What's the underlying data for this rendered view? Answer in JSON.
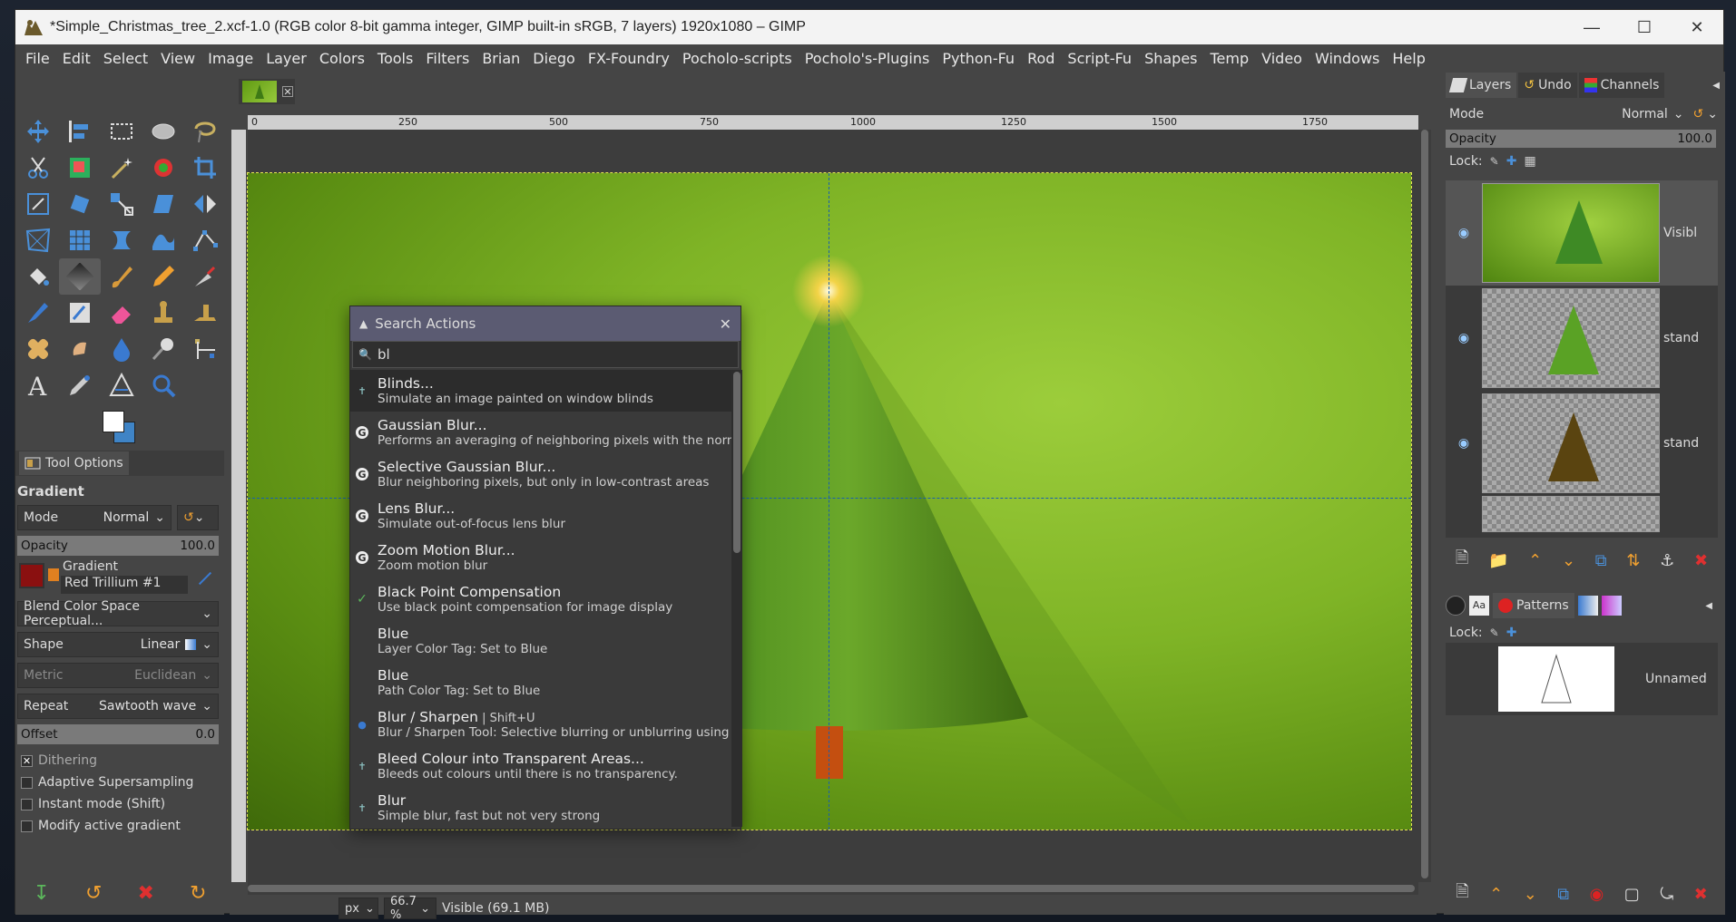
{
  "window": {
    "title": "*Simple_Christmas_tree_2.xcf-1.0 (RGB color 8-bit gamma integer, GIMP built-in sRGB, 7 layers) 1920x1080 – GIMP"
  },
  "menu": [
    "File",
    "Edit",
    "Select",
    "View",
    "Image",
    "Layer",
    "Colors",
    "Tools",
    "Filters",
    "Brian",
    "Diego",
    "FX-Foundry",
    "Pocholo-scripts",
    "Pocholo's-Plugins",
    "Python-Fu",
    "Rod",
    "Script-Fu",
    "Shapes",
    "Temp",
    "Video",
    "Windows",
    "Help"
  ],
  "tool_options": {
    "tab_label": "Tool Options",
    "tool_name": "Gradient",
    "mode_label": "Mode",
    "mode_value": "Normal",
    "opacity_label": "Opacity",
    "opacity_value": "100.0",
    "gradient_label": "Gradient",
    "gradient_value": "Red Trillium #1",
    "blend_space": "Blend Color Space Perceptual...",
    "shape_label": "Shape",
    "shape_value": "Linear",
    "metric_label": "Metric",
    "metric_value": "Euclidean",
    "repeat_label": "Repeat",
    "repeat_value": "Sawtooth wave",
    "offset_label": "Offset",
    "offset_value": "0.0",
    "checks": [
      {
        "label": "Dithering",
        "checked": true
      },
      {
        "label": "Adaptive Supersampling",
        "checked": false
      },
      {
        "label": "Instant mode  (Shift)",
        "checked": false
      },
      {
        "label": "Modify active gradient",
        "checked": false
      }
    ]
  },
  "ruler": [
    "0",
    "250",
    "500",
    "750",
    "1000",
    "1250",
    "1500",
    "1750"
  ],
  "status": {
    "unit": "px",
    "zoom": "66.7 %",
    "info": "Visible (69.1 MB)"
  },
  "search_dialog": {
    "title": "Search Actions",
    "query": "bl",
    "results": [
      {
        "name": "Blinds...",
        "desc": "Simulate an image painted on window blinds"
      },
      {
        "name": "Gaussian Blur...",
        "desc": "Performs an averaging of neighboring pixels with the normal dis"
      },
      {
        "name": "Selective Gaussian Blur...",
        "desc": "Blur neighboring pixels, but only in low-contrast areas"
      },
      {
        "name": "Lens Blur...",
        "desc": "Simulate out-of-focus lens blur"
      },
      {
        "name": "Zoom Motion Blur...",
        "desc": "Zoom motion blur"
      },
      {
        "name": "Black Point Compensation",
        "desc": "Use black point compensation for image display"
      },
      {
        "name": "Blue",
        "desc": "Layer Color Tag: Set to Blue"
      },
      {
        "name": "Blue",
        "desc": "Path Color Tag: Set to Blue"
      },
      {
        "name": "Blur / Sharpen",
        "shortcut": "Shift+U",
        "desc": "Blur / Sharpen Tool: Selective blurring or unblurring using a bru"
      },
      {
        "name": "Bleed Colour into Transparent Areas...",
        "desc": "Bleeds out colours until there is no transparency."
      },
      {
        "name": "Blur",
        "desc": "Simple blur, fast but not very strong"
      }
    ]
  },
  "dock": {
    "tabs": [
      "Layers",
      "Undo",
      "Channels"
    ],
    "mode_label": "Mode",
    "mode_value": "Normal",
    "opacity_label": "Opacity",
    "opacity_value": "100.0",
    "lock_label": "Lock:",
    "layers": [
      "Visibl",
      "stand",
      "stand",
      ""
    ],
    "patterns_tab": "Patterns",
    "pattern_lock": "Lock:",
    "pattern_name": "Unnamed"
  }
}
